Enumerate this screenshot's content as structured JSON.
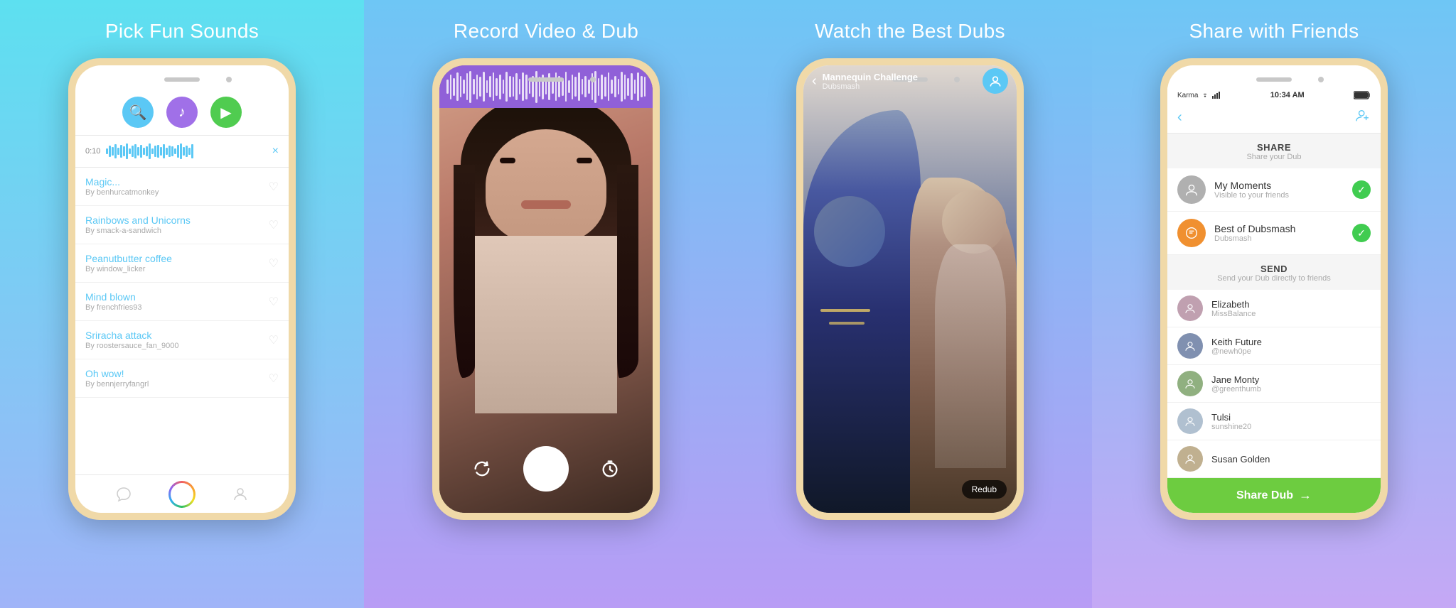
{
  "panels": [
    {
      "id": "panel-1",
      "title": "Pick Fun Sounds",
      "tabs": [
        {
          "icon": "🔍",
          "color": "#5bc8f5",
          "label": "search-tab"
        },
        {
          "icon": "♪",
          "color": "#a070e8",
          "label": "music-tab"
        },
        {
          "icon": "📹",
          "color": "#50cc50",
          "label": "video-tab"
        }
      ],
      "playing": {
        "time": "0:10",
        "close": "×"
      },
      "songs": [
        {
          "name": "Magic...",
          "author": "By benhurcatmonkey"
        },
        {
          "name": "Rainbows and Unicorns",
          "author": "By smack-a-sandwich"
        },
        {
          "name": "Peanutbutter coffee",
          "author": "By window_licker"
        },
        {
          "name": "Mind blown",
          "author": "By frenchfries93"
        },
        {
          "name": "Sriracha attack",
          "author": "By roostersauce_fan_9000"
        },
        {
          "name": "Oh wow!",
          "author": "By bennjerryfangrl"
        }
      ]
    },
    {
      "id": "panel-2",
      "title": "Record Video & Dub"
    },
    {
      "id": "panel-3",
      "title": "Watch the Best Dubs",
      "video": {
        "title": "Mannequin Challenge",
        "subtitle": "Dubsmash"
      },
      "redub_label": "Redub"
    },
    {
      "id": "panel-4",
      "title": "Share with Friends",
      "status_bar": {
        "carrier": "Karma",
        "time": "10:34 AM",
        "battery": "▋"
      },
      "share_section": {
        "header": "SHARE",
        "subtext": "Share your Dub",
        "items": [
          {
            "name": "My Moments",
            "sub": "Visible to your friends",
            "color": "#a0a0a0",
            "checked": true
          },
          {
            "name": "Best of Dubsmash",
            "sub": "Dubsmash",
            "color": "#f09030",
            "checked": true
          }
        ]
      },
      "send_section": {
        "header": "SEND",
        "subtext": "Send your Dub directly to friends",
        "contacts": [
          {
            "name": "Elizabeth",
            "sub": "MissBalance",
            "color": "#c0a0b0"
          },
          {
            "name": "Keith Future",
            "sub": "@newh0pe",
            "color": "#8090b0"
          },
          {
            "name": "Jane Monty",
            "sub": "@greenthumb",
            "color": "#90b080"
          },
          {
            "name": "Tulsi",
            "sub": "sunshine20",
            "color": "#b0c0d0"
          },
          {
            "name": "Susan Golden",
            "sub": "",
            "color": "#c0b090"
          }
        ]
      },
      "share_dub_label": "Share Dub",
      "back_label": "<",
      "add_person_label": "👤+"
    }
  ]
}
